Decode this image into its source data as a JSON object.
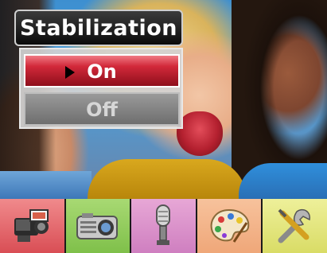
{
  "menu": {
    "title": "Stabilization",
    "options": [
      {
        "label": "On",
        "selected": true
      },
      {
        "label": "Off",
        "selected": false
      }
    ]
  },
  "toolbar": {
    "items": [
      {
        "icon": "video-camera-icon",
        "color": "#e2636a"
      },
      {
        "icon": "photo-camera-icon",
        "color": "#91cb5c"
      },
      {
        "icon": "microphone-icon",
        "color": "#da90c9"
      },
      {
        "icon": "palette-icon",
        "color": "#f2b489"
      },
      {
        "icon": "tools-icon",
        "color": "#e4e67d"
      }
    ]
  },
  "colors": {
    "selected_option": "#c8202e",
    "unselected_option": "#7a7a7a",
    "title_bar": "#1a1a1a"
  }
}
